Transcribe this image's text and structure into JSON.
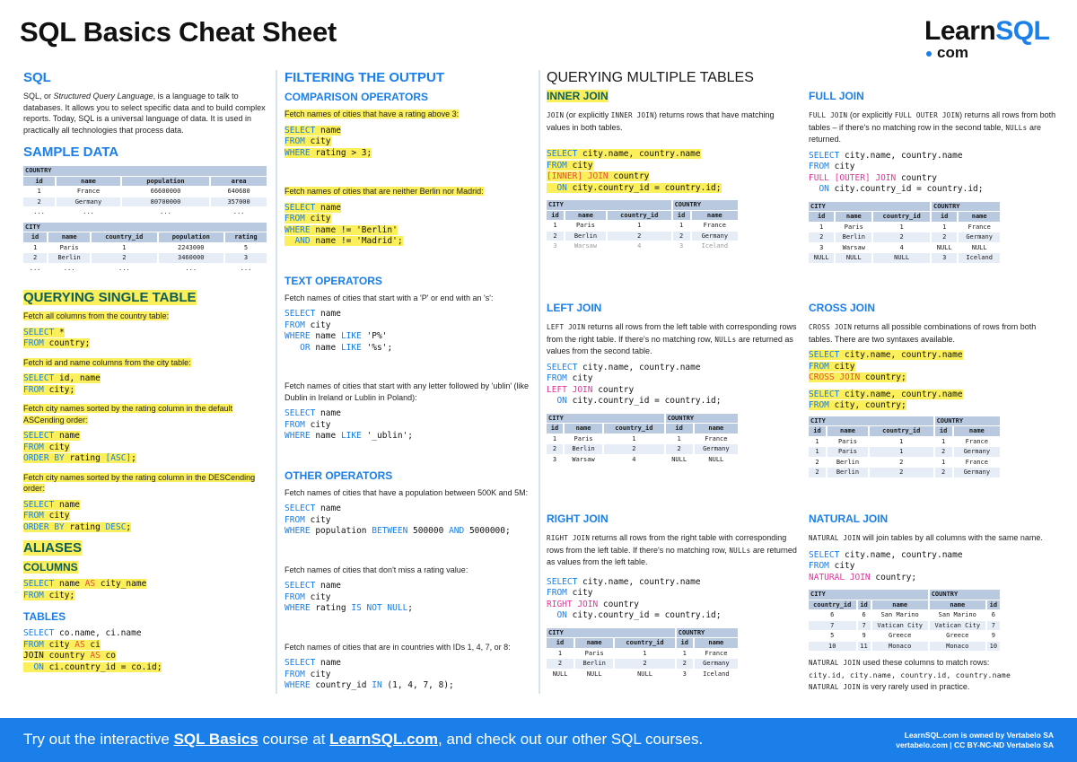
{
  "header": {
    "title": "SQL Basics Cheat Sheet",
    "logo_main": "Learn",
    "logo_accent": "SQL",
    "logo_sub": "com"
  },
  "sql_intro": {
    "heading": "SQL",
    "text_prefix": "SQL, or ",
    "text_italic": "Structured Query Language",
    "text_suffix": ", is a language to talk to databases. It allows you to select specific data and to build complex reports. Today, SQL is a universal language of data. It is used in practically all technologies that process data."
  },
  "sample_data": {
    "heading": "SAMPLE DATA",
    "country": {
      "name": "COUNTRY",
      "columns": [
        "id",
        "name",
        "population",
        "area"
      ],
      "rows": [
        [
          "1",
          "France",
          "66600000",
          "640680"
        ],
        [
          "2",
          "Germany",
          "80700000",
          "357000"
        ],
        [
          "...",
          "...",
          "...",
          "..."
        ]
      ]
    },
    "city": {
      "name": "CITY",
      "columns": [
        "id",
        "name",
        "country_id",
        "population",
        "rating"
      ],
      "rows": [
        [
          "1",
          "Paris",
          "1",
          "2243000",
          "5"
        ],
        [
          "2",
          "Berlin",
          "2",
          "3460000",
          "3"
        ],
        [
          "...",
          "...",
          "...",
          "...",
          "..."
        ]
      ]
    }
  },
  "single_table": {
    "heading": "QUERYING SINGLE TABLE",
    "items": [
      {
        "desc": "Fetch all columns from the country table:",
        "code": [
          "SELECT *",
          "FROM country;"
        ]
      },
      {
        "desc": "Fetch id and name columns from the city table:",
        "code": [
          "SELECT id, name",
          "FROM city;"
        ]
      },
      {
        "desc": "Fetch city names sorted by the rating column in the default ASCending order:",
        "code": [
          "SELECT name",
          "FROM city",
          "ORDER BY rating [ASC];"
        ]
      },
      {
        "desc": "Fetch city names sorted by the rating column in the DESCending order:",
        "code": [
          "SELECT name",
          "FROM city",
          "ORDER BY rating DESC;"
        ]
      }
    ]
  },
  "aliases": {
    "heading": "ALIASES",
    "columns_heading": "COLUMNS",
    "columns_code": [
      "SELECT name AS city_name",
      "FROM city;"
    ],
    "tables_heading": "TABLES",
    "tables_code": [
      "SELECT co.name, ci.name",
      "FROM city AS ci",
      "JOIN country AS co",
      "  ON ci.country_id = co.id;"
    ]
  },
  "filtering": {
    "heading": "FILTERING THE OUTPUT",
    "comparison": {
      "heading": "COMPARISON OPERATORS",
      "items": [
        {
          "desc": "Fetch names of cities that have a rating above 3:",
          "code": [
            "SELECT name",
            "FROM city",
            "WHERE rating > 3;"
          ]
        },
        {
          "desc": "Fetch names of cities that are neither Berlin nor Madrid:",
          "code": [
            "SELECT name",
            "FROM city",
            "WHERE name != 'Berlin'",
            "  AND name != 'Madrid';"
          ]
        }
      ]
    },
    "text": {
      "heading": "TEXT OPERATORS",
      "items": [
        {
          "desc": "Fetch names of cities that start with a 'P' or end with an 's':",
          "code": [
            "SELECT name",
            "FROM city",
            "WHERE name LIKE 'P%'",
            "   OR name LIKE '%s';"
          ]
        },
        {
          "desc": "Fetch names of cities that start with any letter followed by 'ublin' (like Dublin in Ireland or Lublin in Poland):",
          "code": [
            "SELECT name",
            "FROM city",
            "WHERE name LIKE '_ublin';"
          ]
        }
      ]
    },
    "other": {
      "heading": "OTHER OPERATORS",
      "items": [
        {
          "desc": "Fetch names of cities that have a population between 500K and 5M:",
          "code": [
            "SELECT name",
            "FROM city",
            "WHERE population BETWEEN 500000 AND 5000000;"
          ]
        },
        {
          "desc": "Fetch names of cities that don't miss a rating value:",
          "code": [
            "SELECT name",
            "FROM city",
            "WHERE rating IS NOT NULL;"
          ]
        },
        {
          "desc": "Fetch names of cities that are in countries with IDs 1, 4, 7, or 8:",
          "code": [
            "SELECT name",
            "FROM city",
            "WHERE country_id IN (1, 4, 7, 8);"
          ]
        }
      ]
    }
  },
  "multiple_tables": {
    "heading": "QUERYING MULTIPLE TABLES",
    "joins": {
      "inner": {
        "heading": "INNER JOIN",
        "desc": "JOIN (or explicitly INNER JOIN) returns rows that have matching values in both tables.",
        "code": [
          "SELECT city.name, country.name",
          "FROM city",
          "[INNER] JOIN country",
          "  ON city.country_id = country.id;"
        ],
        "table": {
          "left_name": "CITY",
          "right_name": "COUNTRY",
          "columns": [
            "id",
            "name",
            "country_id",
            "id",
            "name"
          ],
          "rows": [
            [
              "1",
              "Paris",
              "1",
              "1",
              "France"
            ],
            [
              "2",
              "Berlin",
              "2",
              "2",
              "Germany"
            ],
            [
              "3",
              "Warsaw",
              "4",
              "3",
              "Iceland"
            ]
          ]
        }
      },
      "left": {
        "heading": "LEFT JOIN",
        "desc": "LEFT JOIN returns all rows from the left table with corresponding rows from the right table. If there's no matching row, NULLs are returned as values from the second table.",
        "code": [
          "SELECT city.name, country.name",
          "FROM city",
          "LEFT JOIN country",
          "  ON city.country_id = country.id;"
        ],
        "table": {
          "left_name": "CITY",
          "right_name": "COUNTRY",
          "columns": [
            "id",
            "name",
            "country_id",
            "id",
            "name"
          ],
          "rows": [
            [
              "1",
              "Paris",
              "1",
              "1",
              "France"
            ],
            [
              "2",
              "Berlin",
              "2",
              "2",
              "Germany"
            ],
            [
              "3",
              "Warsaw",
              "4",
              "NULL",
              "NULL"
            ]
          ]
        }
      },
      "right": {
        "heading": "RIGHT JOIN",
        "desc": "RIGHT JOIN returns all rows from the right table with corresponding rows from the left table. If there's no matching row, NULLs are returned as values from the left table.",
        "code": [
          "SELECT city.name, country.name",
          "FROM city",
          "RIGHT JOIN country",
          "  ON city.country_id = country.id;"
        ],
        "table": {
          "left_name": "CITY",
          "right_name": "COUNTRY",
          "columns": [
            "id",
            "name",
            "country_id",
            "id",
            "name"
          ],
          "rows": [
            [
              "1",
              "Paris",
              "1",
              "1",
              "France"
            ],
            [
              "2",
              "Berlin",
              "2",
              "2",
              "Germany"
            ],
            [
              "NULL",
              "NULL",
              "NULL",
              "3",
              "Iceland"
            ]
          ]
        }
      },
      "full": {
        "heading": "FULL JOIN",
        "desc": "FULL JOIN (or explicitly FULL OUTER JOIN) returns all rows from both tables – if there's no matching row in the second table, NULLs are returned.",
        "code": [
          "SELECT city.name, country.name",
          "FROM city",
          "FULL [OUTER] JOIN country",
          "  ON city.country_id = country.id;"
        ],
        "table": {
          "left_name": "CITY",
          "right_name": "COUNTRY",
          "columns": [
            "id",
            "name",
            "country_id",
            "id",
            "name"
          ],
          "rows": [
            [
              "1",
              "Paris",
              "1",
              "1",
              "France"
            ],
            [
              "2",
              "Berlin",
              "2",
              "2",
              "Germany"
            ],
            [
              "3",
              "Warsaw",
              "4",
              "NULL",
              "NULL"
            ],
            [
              "NULL",
              "NULL",
              "NULL",
              "3",
              "Iceland"
            ]
          ]
        }
      },
      "cross": {
        "heading": "CROSS JOIN",
        "desc": "CROSS JOIN returns all possible combinations of rows from both tables. There are two syntaxes available.",
        "code": [
          "SELECT city.name, country.name",
          "FROM city",
          "CROSS JOIN country;"
        ],
        "code2": [
          "SELECT city.name, country.name",
          "FROM city, country;"
        ],
        "table": {
          "left_name": "CITY",
          "right_name": "COUNTRY",
          "columns": [
            "id",
            "name",
            "country_id",
            "id",
            "name"
          ],
          "rows": [
            [
              "1",
              "Paris",
              "1",
              "1",
              "France"
            ],
            [
              "1",
              "Paris",
              "1",
              "2",
              "Germany"
            ],
            [
              "2",
              "Berlin",
              "2",
              "1",
              "France"
            ],
            [
              "2",
              "Berlin",
              "2",
              "2",
              "Germany"
            ]
          ]
        }
      },
      "natural": {
        "heading": "NATURAL JOIN",
        "desc": "NATURAL JOIN will join tables by all columns with the same name.",
        "code": [
          "SELECT city.name, country.name",
          "FROM city",
          "NATURAL JOIN country;"
        ],
        "table": {
          "left_name": "CITY",
          "right_name": "COUNTRY",
          "columns": [
            "country_id",
            "id",
            "name",
            "name",
            "id"
          ],
          "rows": [
            [
              "6",
              "6",
              "San Marino",
              "San Marino",
              "6"
            ],
            [
              "7",
              "7",
              "Vatican City",
              "Vatican City",
              "7"
            ],
            [
              "5",
              "9",
              "Greece",
              "Greece",
              "9"
            ],
            [
              "10",
              "11",
              "Monaco",
              "Monaco",
              "10"
            ]
          ]
        },
        "note1": "NATURAL JOIN used these columns to match rows:",
        "note2": "city.id, city.name, country.id, country.name",
        "note3": "NATURAL JOIN is very rarely used in practice."
      }
    }
  },
  "footer": {
    "cta_1": "Try out the interactive ",
    "cta_link1": "SQL Basics",
    "cta_2": " course at ",
    "cta_link2": "LearnSQL.com",
    "cta_3": ", and check out our other SQL courses.",
    "owner_1": "LearnSQL.com is owned by Vertabelo SA",
    "owner_2": "vertabelo.com | CC BY-NC-ND Vertabelo SA"
  }
}
